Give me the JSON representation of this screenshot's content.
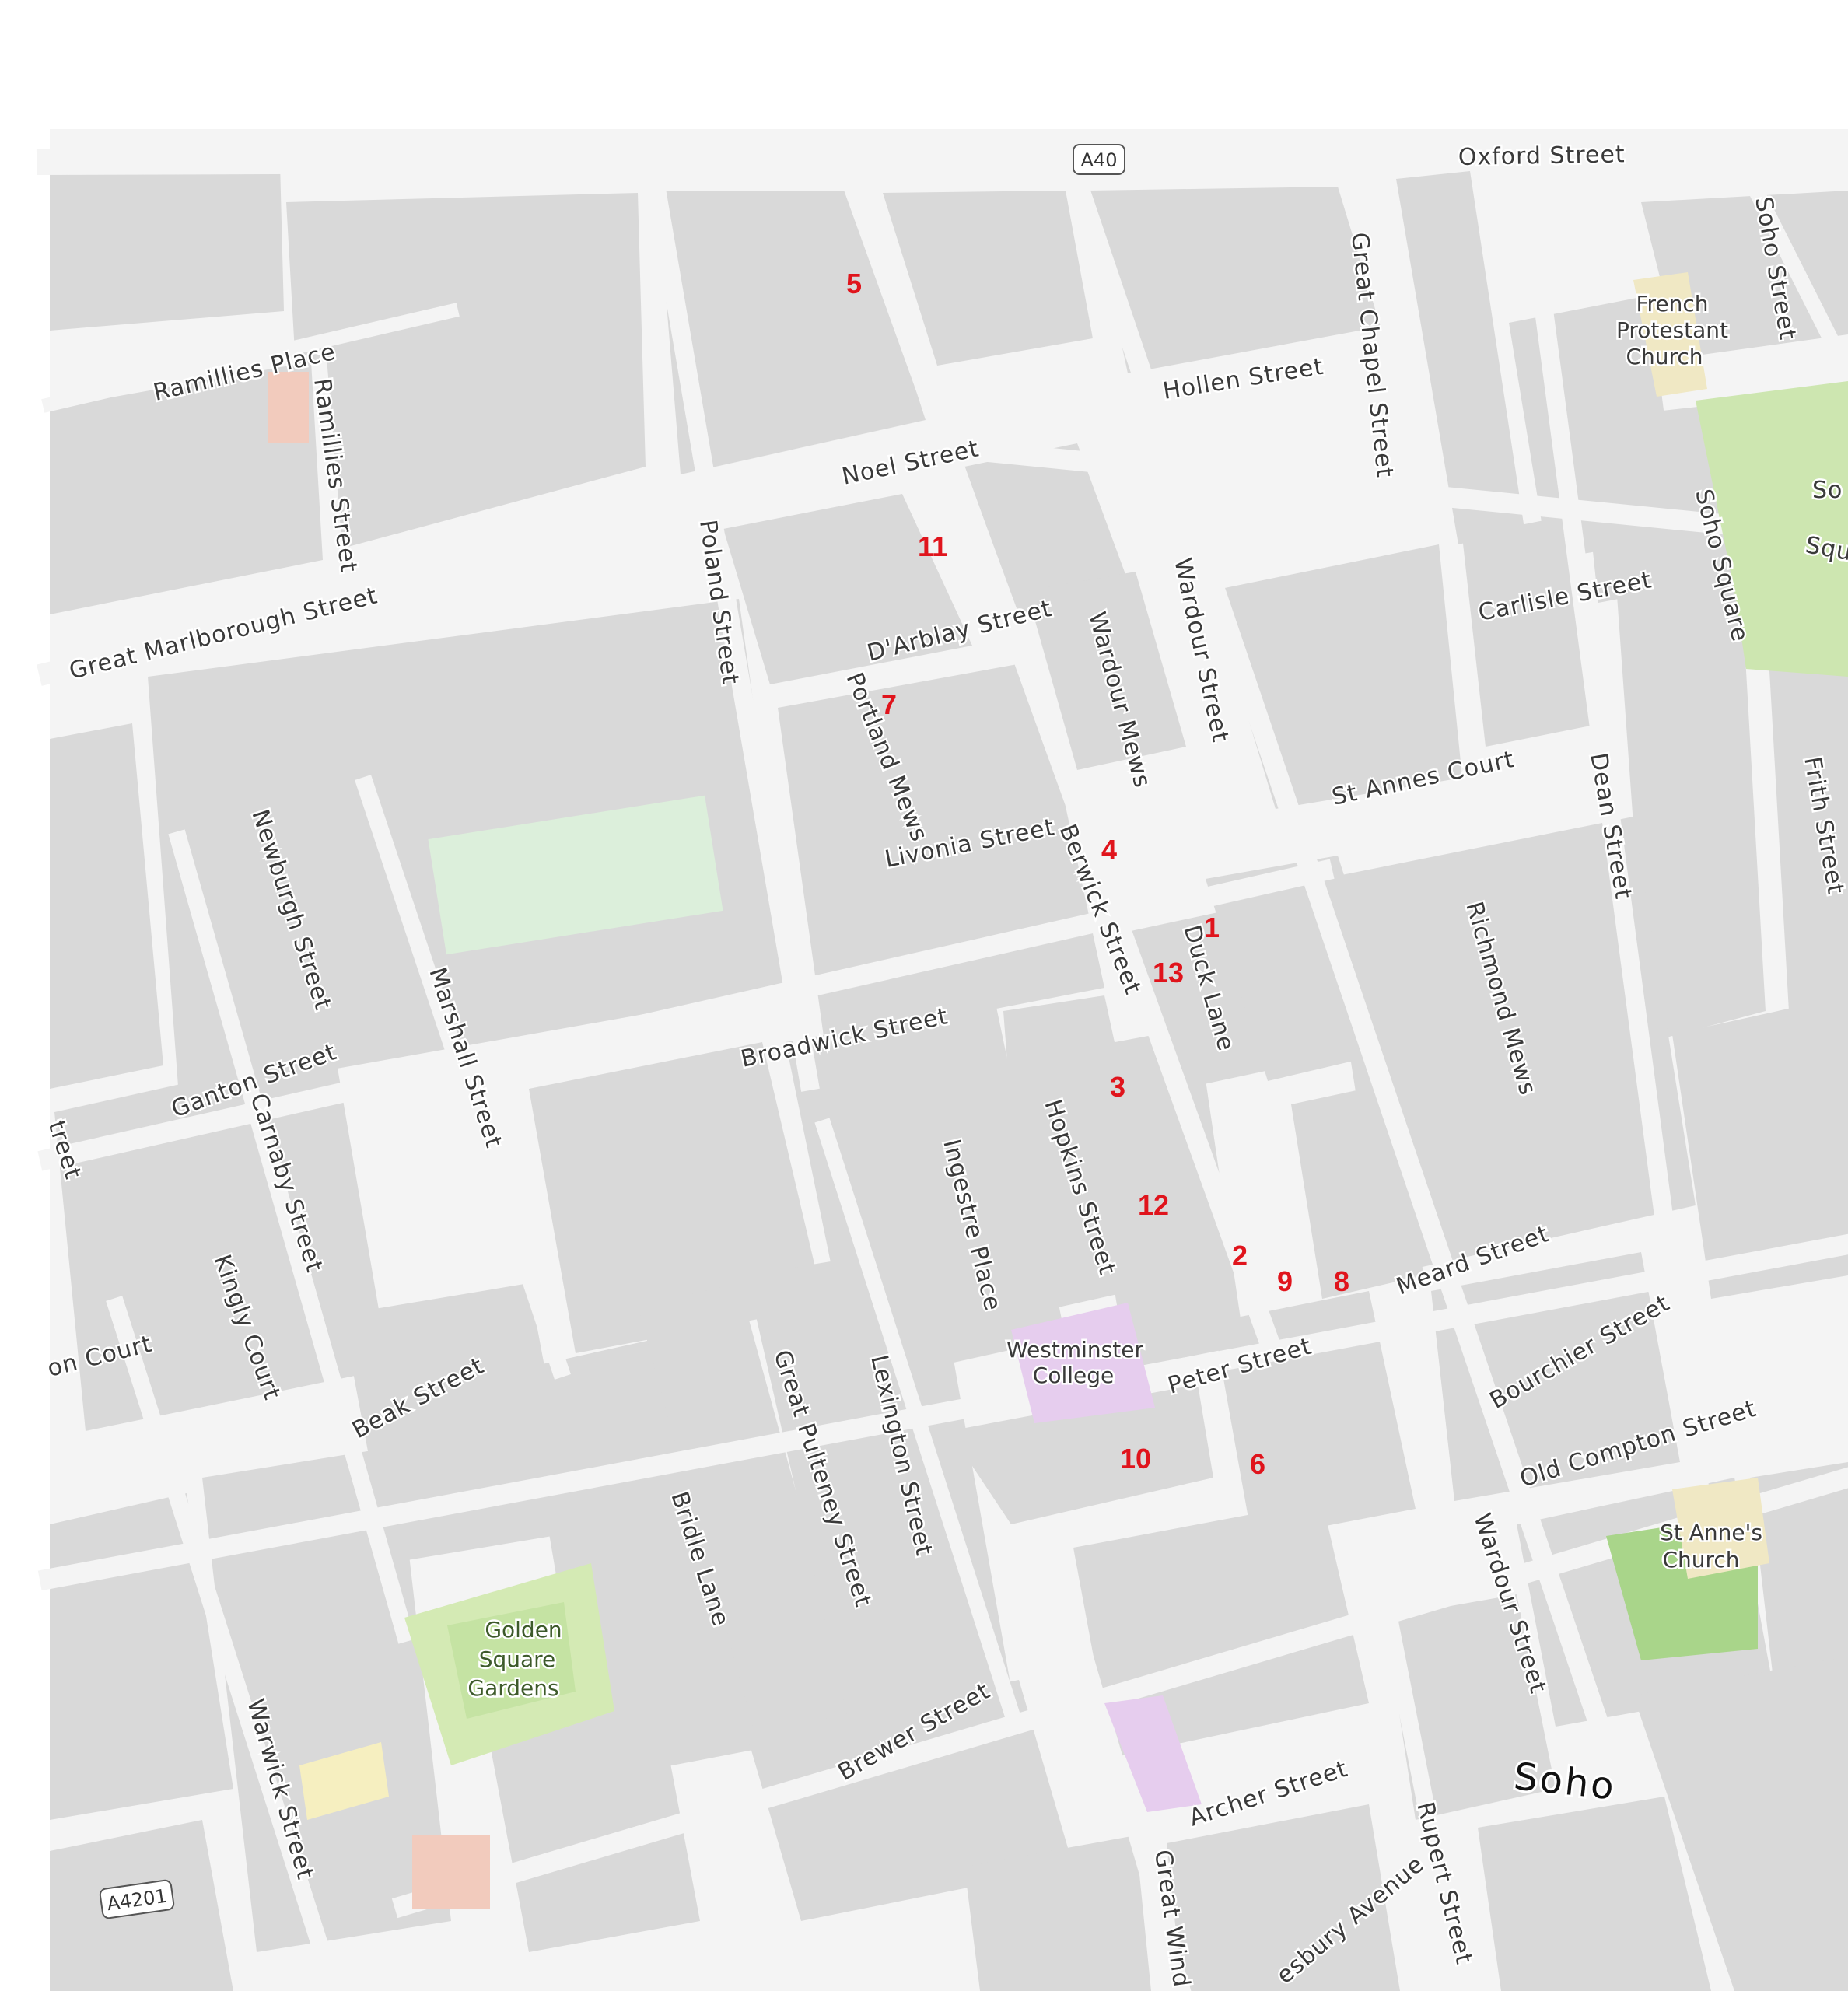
{
  "map": {
    "area_label": "Soho",
    "colors": {
      "block": "#d9d9d9",
      "road": "#f4f4f4",
      "park": "#d4eab4",
      "park_inner": "#c5e3a3",
      "green_field": "#dcefdb",
      "church": "#f0e8c4",
      "college": "#e6cdee",
      "pink_building": "#f2cbbd",
      "yellow_building": "#f6efc0",
      "marker": "#e0141c"
    },
    "road_shields": [
      {
        "id": "a40",
        "text": "A40"
      },
      {
        "id": "a4201",
        "text": "A4201"
      }
    ],
    "streets": [
      {
        "id": "oxford",
        "text": "Oxford Street"
      },
      {
        "id": "ramillies-place",
        "text": "Ramillies Place"
      },
      {
        "id": "ramillies-street",
        "text": "Ramillies Street"
      },
      {
        "id": "great-marlborough",
        "text": "Great Marlborough Street"
      },
      {
        "id": "noel",
        "text": "Noel Street"
      },
      {
        "id": "hollen",
        "text": "Hollen Street"
      },
      {
        "id": "great-chapel",
        "text": "Great Chapel Street"
      },
      {
        "id": "soho-street",
        "text": "Soho Street"
      },
      {
        "id": "soho-square-road",
        "text": "Soho Square"
      },
      {
        "id": "soho-square-park",
        "text": "So"
      },
      {
        "id": "soho-square-park2",
        "text": "Squ"
      },
      {
        "id": "carlisle",
        "text": "Carlisle Street"
      },
      {
        "id": "poland",
        "text": "Poland Street"
      },
      {
        "id": "darblay",
        "text": "D'Arblay Street"
      },
      {
        "id": "wardour-mews",
        "text": "Wardour Mews"
      },
      {
        "id": "wardour-north",
        "text": "Wardour Street"
      },
      {
        "id": "portland-mews",
        "text": "Portland Mews"
      },
      {
        "id": "livonia",
        "text": "Livonia Street"
      },
      {
        "id": "st-annes-court",
        "text": "St Annes Court"
      },
      {
        "id": "dean",
        "text": "Dean Street"
      },
      {
        "id": "frith",
        "text": "Frith Street"
      },
      {
        "id": "berwick",
        "text": "Berwick Street"
      },
      {
        "id": "duck-lane",
        "text": "Duck Lane"
      },
      {
        "id": "richmond-mews",
        "text": "Richmond Mews"
      },
      {
        "id": "newburgh",
        "text": "Newburgh Street"
      },
      {
        "id": "marshall",
        "text": "Marshall Street"
      },
      {
        "id": "broadwick",
        "text": "Broadwick Street"
      },
      {
        "id": "ganton",
        "text": "Ganton Street"
      },
      {
        "id": "carnaby",
        "text": "Carnaby Street"
      },
      {
        "id": "hopkins",
        "text": "Hopkins Street"
      },
      {
        "id": "ingestre",
        "text": "Ingestre Place"
      },
      {
        "id": "kingly-court",
        "text": "Kingly Court"
      },
      {
        "id": "court-partial",
        "text": "on Court"
      },
      {
        "id": "street-partial",
        "text": "treet"
      },
      {
        "id": "meard",
        "text": "Meard Street"
      },
      {
        "id": "peter",
        "text": "Peter Street"
      },
      {
        "id": "bourchier",
        "text": "Bourchier Street"
      },
      {
        "id": "old-compton",
        "text": "Old Compton Street"
      },
      {
        "id": "beak",
        "text": "Beak Street"
      },
      {
        "id": "bridle-lane",
        "text": "Bridle Lane"
      },
      {
        "id": "great-pulteney",
        "text": "Great Pulteney Street"
      },
      {
        "id": "lexington",
        "text": "Lexington Street"
      },
      {
        "id": "wardour-south",
        "text": "Wardour Street"
      },
      {
        "id": "brewer",
        "text": "Brewer Street"
      },
      {
        "id": "warwick",
        "text": "Warwick Street"
      },
      {
        "id": "archer",
        "text": "Archer Street"
      },
      {
        "id": "great-wind",
        "text": "Great Wind"
      },
      {
        "id": "rupert",
        "text": "Rupert Street"
      },
      {
        "id": "shaftesbury",
        "text": "esbury Avenue"
      }
    ],
    "pois": [
      {
        "id": "french-church-1",
        "text": "French"
      },
      {
        "id": "french-church-2",
        "text": "Protestant"
      },
      {
        "id": "french-church-3",
        "text": "Church"
      },
      {
        "id": "westminster-1",
        "text": "Westminster"
      },
      {
        "id": "westminster-2",
        "text": "College"
      },
      {
        "id": "st-annes-1",
        "text": "St Anne's"
      },
      {
        "id": "st-annes-2",
        "text": "Church"
      },
      {
        "id": "golden-1",
        "text": "Golden"
      },
      {
        "id": "golden-2",
        "text": "Square"
      },
      {
        "id": "golden-3",
        "text": "Gardens"
      }
    ],
    "markers": [
      {
        "id": "m1",
        "text": "1"
      },
      {
        "id": "m2",
        "text": "2"
      },
      {
        "id": "m3",
        "text": "3"
      },
      {
        "id": "m4",
        "text": "4"
      },
      {
        "id": "m5",
        "text": "5"
      },
      {
        "id": "m6",
        "text": "6"
      },
      {
        "id": "m7",
        "text": "7"
      },
      {
        "id": "m8",
        "text": "8"
      },
      {
        "id": "m9",
        "text": "9"
      },
      {
        "id": "m10",
        "text": "10"
      },
      {
        "id": "m11",
        "text": "11"
      },
      {
        "id": "m12",
        "text": "12"
      },
      {
        "id": "m13",
        "text": "13"
      }
    ]
  }
}
